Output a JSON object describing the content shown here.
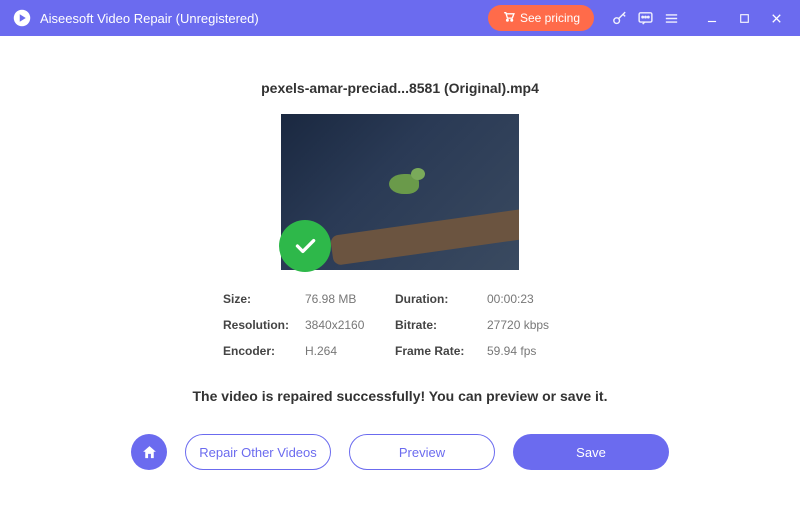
{
  "titlebar": {
    "app_title": "Aiseesoft Video Repair (Unregistered)",
    "pricing_label": "See pricing"
  },
  "file": {
    "name": "pexels-amar-preciad...8581 (Original).mp4"
  },
  "info": {
    "size_label": "Size:",
    "size_value": "76.98 MB",
    "duration_label": "Duration:",
    "duration_value": "00:00:23",
    "resolution_label": "Resolution:",
    "resolution_value": "3840x2160",
    "bitrate_label": "Bitrate:",
    "bitrate_value": "27720 kbps",
    "encoder_label": "Encoder:",
    "encoder_value": "H.264",
    "framerate_label": "Frame Rate:",
    "framerate_value": "59.94 fps"
  },
  "status": {
    "message": "The video is repaired successfully! You can preview or save it."
  },
  "actions": {
    "repair_other": "Repair Other Videos",
    "preview": "Preview",
    "save": "Save"
  }
}
